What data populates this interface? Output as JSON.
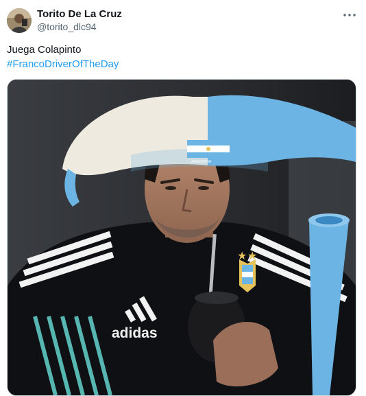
{
  "post": {
    "display_name": "Torito De La Cruz",
    "handle": "@torito_dlc94",
    "text": "Juega Colapinto",
    "hashtag": "#FrancoDriverOfTheDay",
    "more_icon": "more-horizontal-icon"
  },
  "image": {
    "jersey_brand": "adidas",
    "flag_text": "ARGENTINA"
  },
  "colors": {
    "link": "#1d9bf0",
    "handle": "#536471",
    "sky_blue": "#6cb4e4"
  }
}
